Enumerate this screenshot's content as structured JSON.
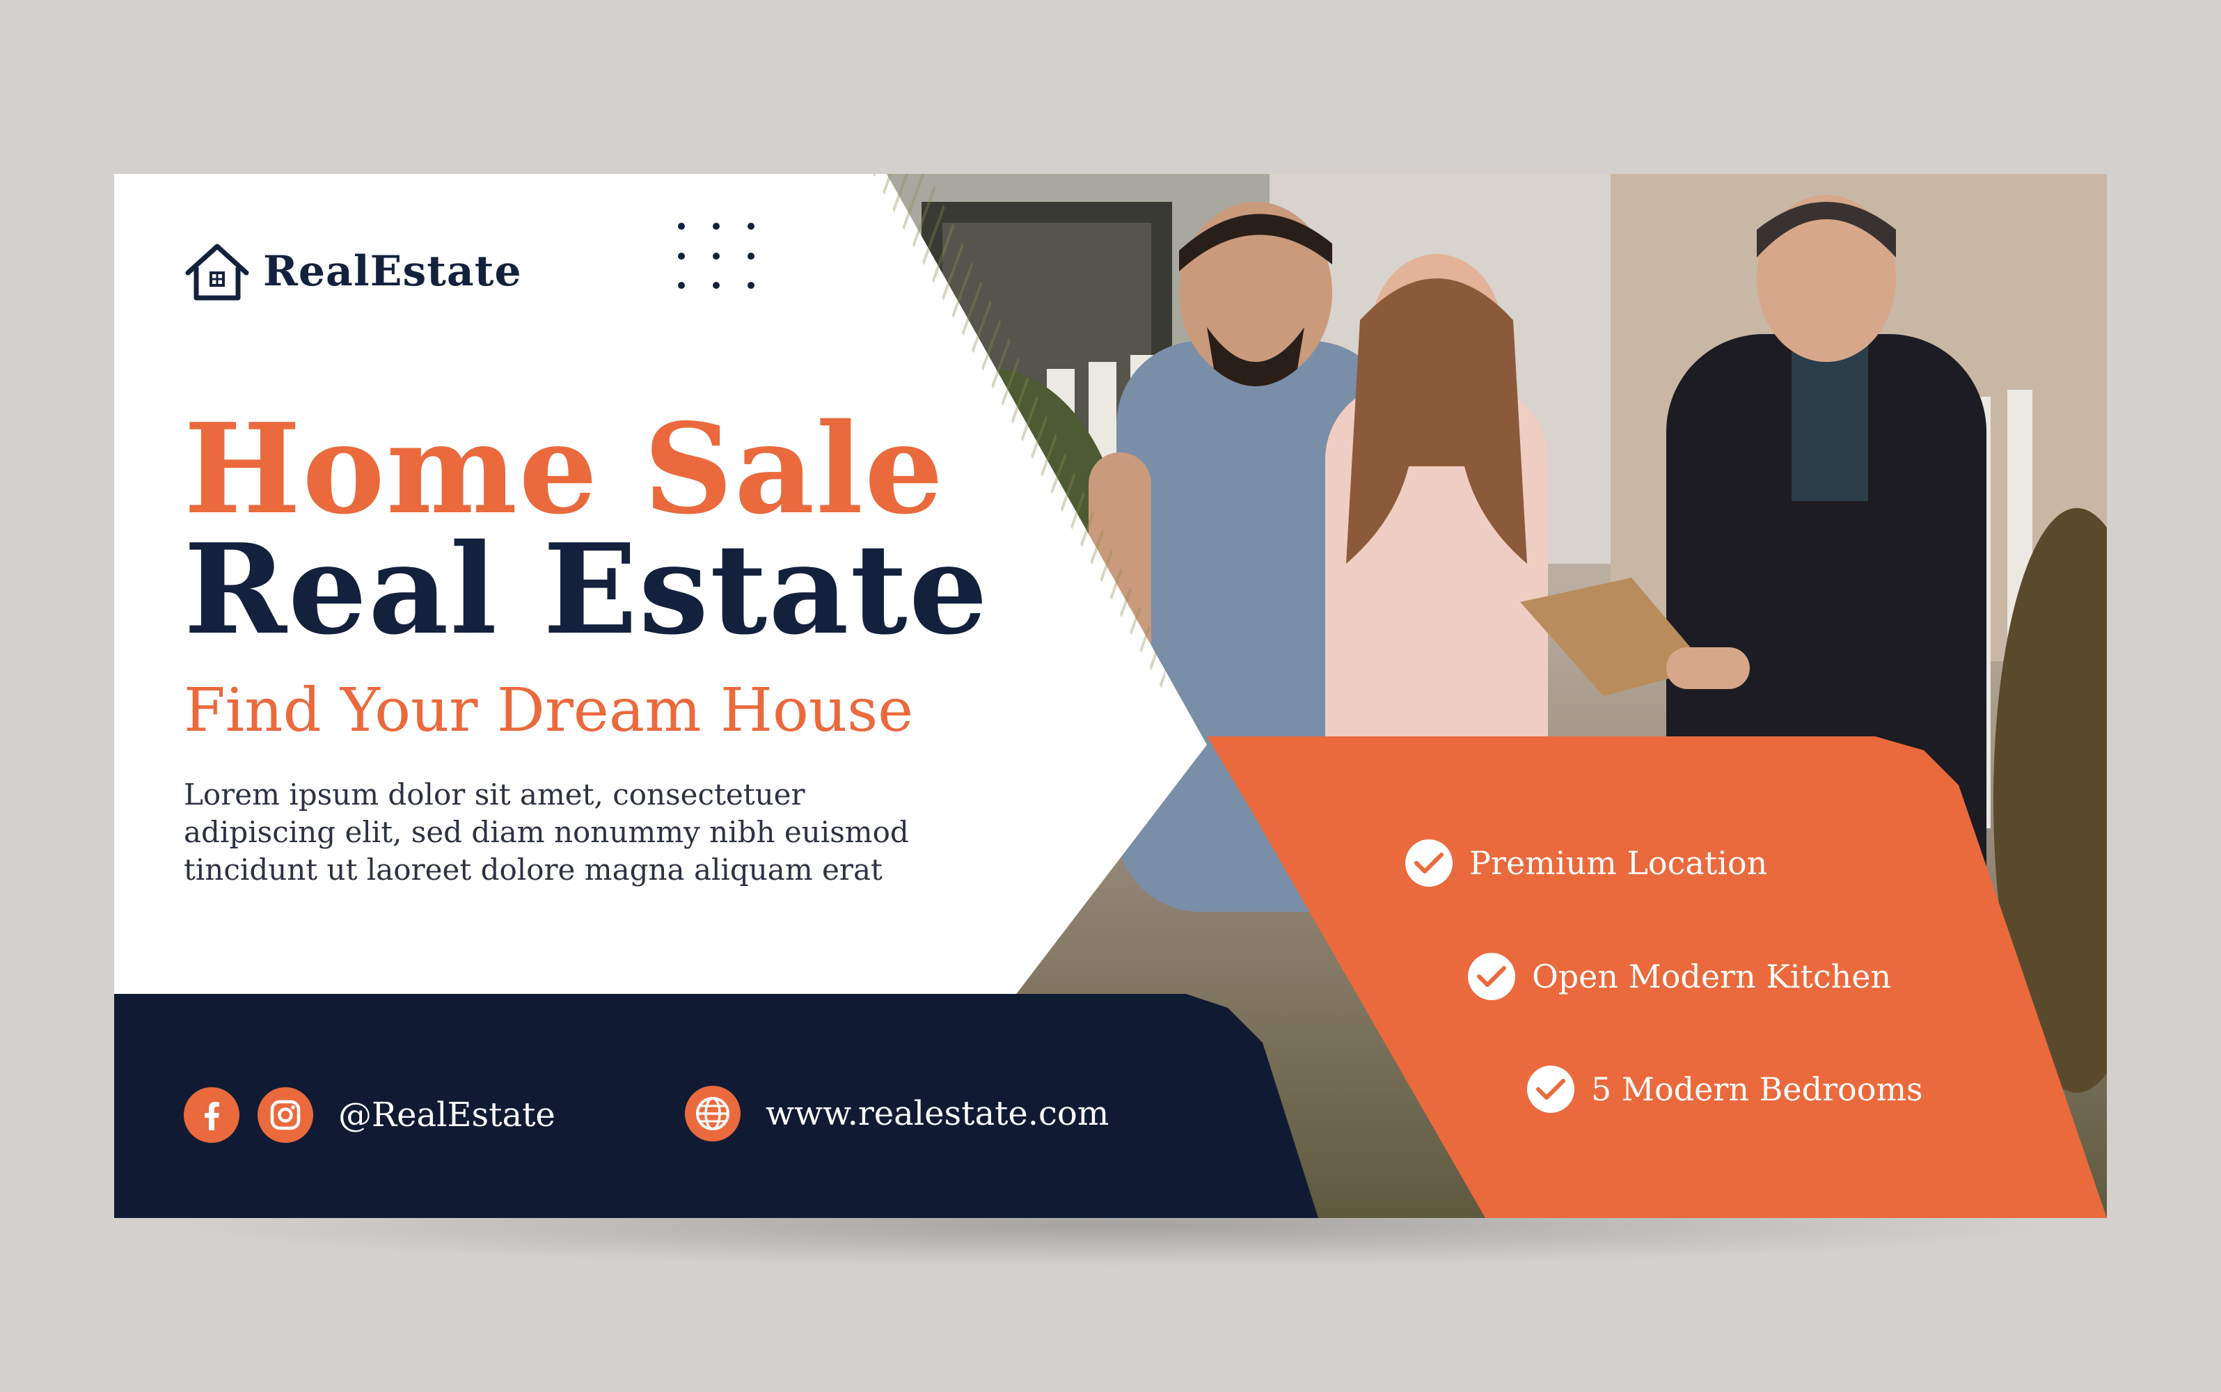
{
  "brand": {
    "name": "RealEstate"
  },
  "headline": {
    "line1": "Home Sale",
    "line2": "Real Estate",
    "tagline": "Find Your Dream House"
  },
  "description": "Lorem ipsum dolor sit amet, consectetuer adipiscing elit, sed diam nonummy nibh euismod tincidunt ut laoreet dolore magna aliquam erat",
  "features": [
    {
      "label": "Premium Location"
    },
    {
      "label": "Open Modern Kitchen"
    },
    {
      "label": "5 Modern Bedrooms"
    }
  ],
  "contact": {
    "social_handle": "@RealEstate",
    "website": "www.realestate.com"
  },
  "icons": {
    "logo": "house-icon",
    "social": [
      "facebook-icon",
      "instagram-icon"
    ],
    "web": "globe-icon",
    "feature": "checkmark-icon"
  },
  "colors": {
    "accent": "#ea6a3d",
    "navy": "#101b33",
    "heading_dark": "#14213d",
    "canvas": "#d3d0cd"
  }
}
